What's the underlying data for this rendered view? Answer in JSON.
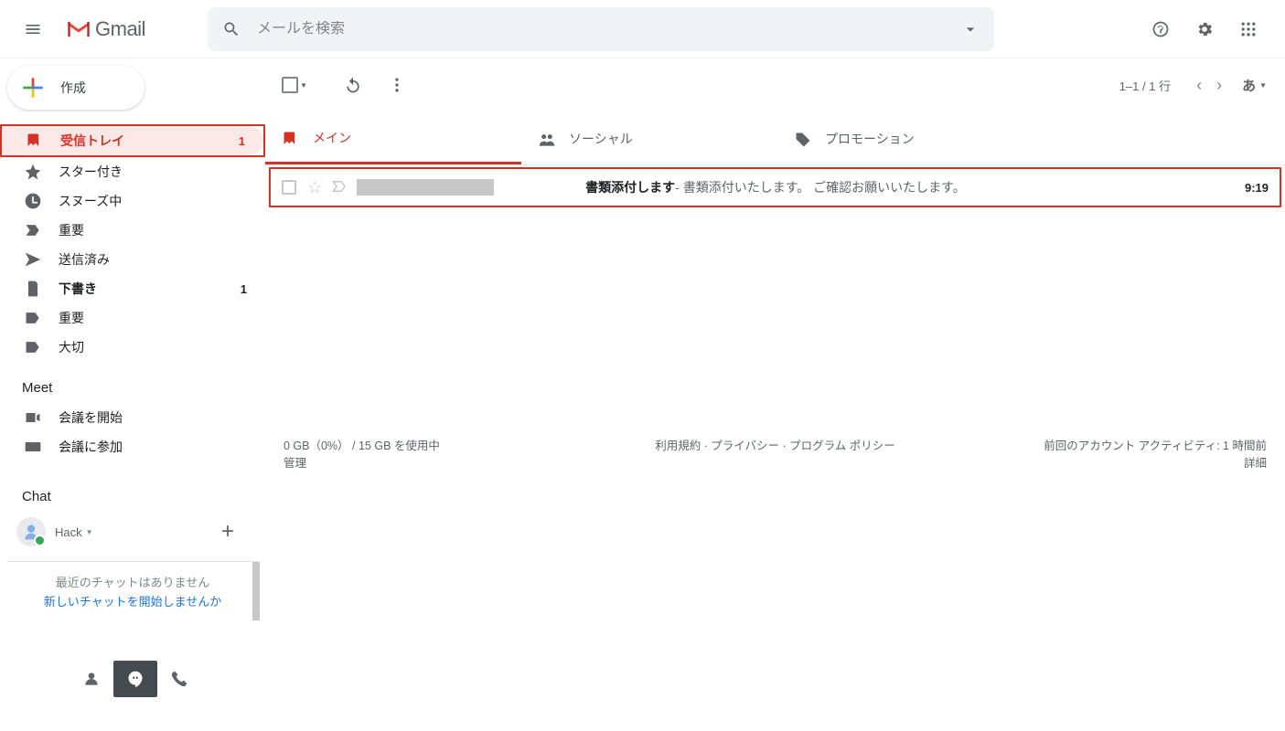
{
  "header": {
    "app_name": "Gmail",
    "search_placeholder": "メールを検索"
  },
  "compose": {
    "label": "作成"
  },
  "sidebar": {
    "items": [
      {
        "label": "受信トレイ",
        "count": "1"
      },
      {
        "label": "スター付き"
      },
      {
        "label": "スヌーズ中"
      },
      {
        "label": "重要"
      },
      {
        "label": "送信済み"
      },
      {
        "label": "下書き",
        "count": "1"
      },
      {
        "label": "重要"
      },
      {
        "label": "大切"
      }
    ]
  },
  "meet": {
    "title": "Meet",
    "start": "会議を開始",
    "join": "会議に参加"
  },
  "chat": {
    "title": "Chat",
    "user_name": "Hack",
    "empty1": "最近のチャットはありません",
    "empty2": "新しいチャットを開始しませんか"
  },
  "toolbar": {
    "page_count": "1–1 / 1 行",
    "ime_label": "あ"
  },
  "tabs": {
    "main": "メイン",
    "social": "ソーシャル",
    "promo": "プロモーション"
  },
  "mail": {
    "subject": "書類添付します",
    "snippet": " - 書類添付いたします。 ご確認お願いいたします。",
    "date": "9:19"
  },
  "footer": {
    "storage1": "0 GB（0%） / 15 GB を使用中",
    "storage2": "管理",
    "center": "利用規約 · プライバシー · プログラム ポリシー",
    "activity1": "前回のアカウント アクティビティ: 1 時間前",
    "activity2": "詳細"
  }
}
